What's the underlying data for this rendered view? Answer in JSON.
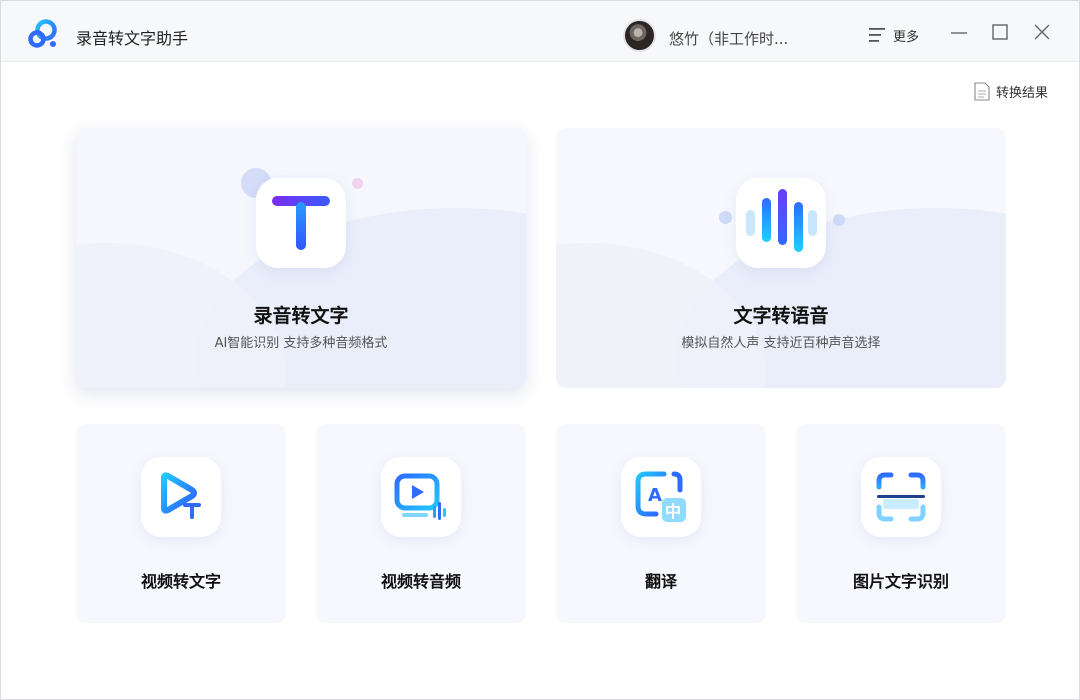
{
  "app": {
    "title": "录音转文字助手"
  },
  "user": {
    "name": "悠竹（非工作时..."
  },
  "header": {
    "more_label": "更多"
  },
  "toolbar": {
    "result_label": "转换结果"
  },
  "features": {
    "main": [
      {
        "title": "录音转文字",
        "subtitle": "AI智能识别 支持多种音频格式",
        "icon": "text-t-icon"
      },
      {
        "title": "文字转语音",
        "subtitle": "模拟自然人声 支持近百种声音选择",
        "icon": "sound-wave-icon"
      }
    ],
    "tools": [
      {
        "title": "视频转文字",
        "icon": "video-to-text-icon"
      },
      {
        "title": "视频转音频",
        "icon": "video-to-audio-icon"
      },
      {
        "title": "翻译",
        "icon": "translate-icon"
      },
      {
        "title": "图片文字识别",
        "icon": "scan-ocr-icon"
      }
    ]
  },
  "colors": {
    "accent": "#2f6bff",
    "accent_cyan": "#1fd0ff",
    "accent_purple": "#6a3df5"
  }
}
